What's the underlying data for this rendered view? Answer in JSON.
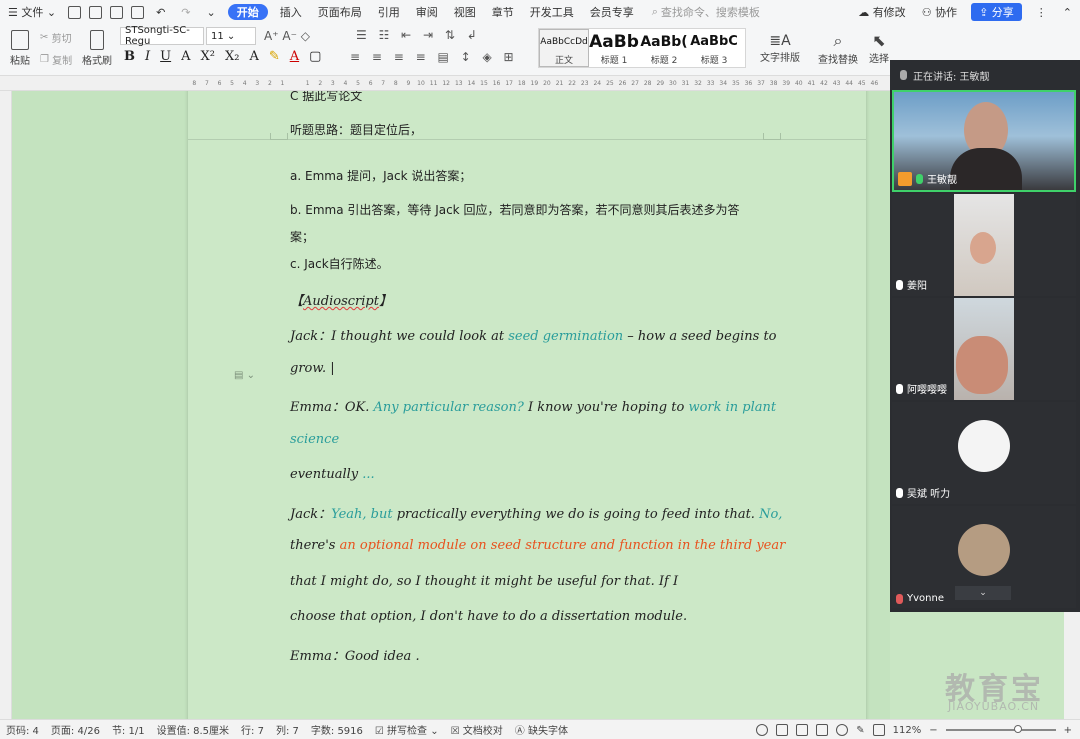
{
  "menu": {
    "file": "文件",
    "tabs": [
      "开始",
      "插入",
      "页面布局",
      "引用",
      "审阅",
      "视图",
      "章节",
      "开发工具",
      "会员专享"
    ],
    "active_tab": "开始",
    "search_placeholder": "查找命令、搜索模板",
    "has_changes": "有修改",
    "collaborate": "协作",
    "share": "分享"
  },
  "ribbon": {
    "paste": "粘贴",
    "cut": "剪切",
    "copy": "复制",
    "format_painter": "格式刷",
    "font_name": "STSongti-SC-Regu",
    "font_size": "11",
    "styles": [
      {
        "preview": "AaBbCcDd",
        "label": "正文"
      },
      {
        "preview": "AaBb",
        "label": "标题 1"
      },
      {
        "preview": "AaBb(",
        "label": "标题 2"
      },
      {
        "preview": "AaBbC",
        "label": "标题 3"
      }
    ],
    "text_layout": "文字排版",
    "find_replace": "查找替换",
    "select": "选择"
  },
  "ruler": [
    "8",
    "7",
    "6",
    "5",
    "4",
    "3",
    "2",
    "1",
    "",
    "1",
    "2",
    "3",
    "4",
    "5",
    "6",
    "7",
    "8",
    "9",
    "10",
    "11",
    "12",
    "13",
    "14",
    "15",
    "16",
    "17",
    "18",
    "19",
    "20",
    "21",
    "22",
    "23",
    "24",
    "25",
    "26",
    "27",
    "28",
    "29",
    "30",
    "31",
    "32",
    "33",
    "34",
    "35",
    "36",
    "37",
    "38",
    "39",
    "40",
    "41",
    "42",
    "43",
    "44",
    "45",
    "46"
  ],
  "doc": {
    "l1": "C  据此写论文",
    "l2": "听题思路：题目定位后，",
    "l3": "a. Emma 提问，Jack 说出答案；",
    "l4": "b. Emma 引出答案，等待 Jack 回应，若同意即为答案，若不同意则其后表述多为答",
    "l5": "案；",
    "l6": "c. Jack自行陈述。",
    "l7_pre": "【",
    "l7_word": "Audioscript",
    "l7_post": "】",
    "l8_a": "Jack：I thought we could look at ",
    "l8_b": "seed germination",
    "l8_c": " – how a seed begins to",
    "l9": "grow. |",
    "l10_a": "Emma：OK. ",
    "l10_b": "Any particular reason?",
    "l10_c": " I know you're hoping to ",
    "l10_d": "work in plant",
    "l11": "science",
    "l12_a": "eventually ",
    "l12_b": "...",
    "l13_a": "Jack：",
    "l13_b": "Yeah, but",
    "l13_c": " practically everything we do is going to feed into that. ",
    "l13_d": "No,",
    "l14_a": "there's ",
    "l14_b": "an optional module on seed structure and function in the third year",
    "l15": "that I might do, so I thought it might be useful for that. If I",
    "l16": "choose that option, I don't have to do a dissertation module.",
    "l17": "Emma：Good idea ."
  },
  "meeting": {
    "speaking": "正在讲话: 王敏靓",
    "participants": [
      "王敏靓",
      "姜阳",
      "阿嘤嘤嘤",
      "吴斌 听力",
      "Yvonne"
    ]
  },
  "status": {
    "page_code": "页码: 4",
    "page": "页面: 4/26",
    "section": "节: 1/1",
    "setting": "设置值: 8.5厘米",
    "row": "行: 7",
    "col": "列: 7",
    "word_count": "字数: 5916",
    "spell_check": "拼写检查",
    "doc_proof": "文档校对",
    "missing_font": "缺失字体",
    "zoom": "112%",
    "zoom_fraction": 0.62
  },
  "watermark": {
    "cn": "教育宝",
    "en": "JIAOYUBAO.CN"
  }
}
